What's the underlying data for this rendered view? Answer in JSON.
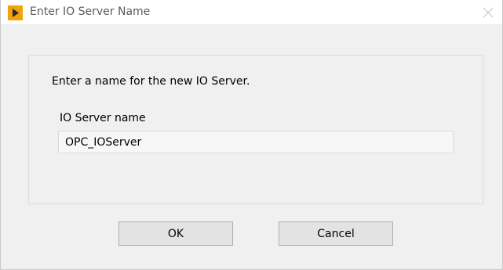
{
  "window": {
    "title": "Enter IO Server Name",
    "app_icon": "play-triangle-icon",
    "close_icon": "close-icon",
    "accent_color": "#f0a30a"
  },
  "dialog": {
    "prompt": "Enter a name for the new IO Server.",
    "field_label": "IO Server name",
    "field_value": "OPC_IOServer"
  },
  "buttons": {
    "ok_label": "OK",
    "cancel_label": "Cancel"
  }
}
